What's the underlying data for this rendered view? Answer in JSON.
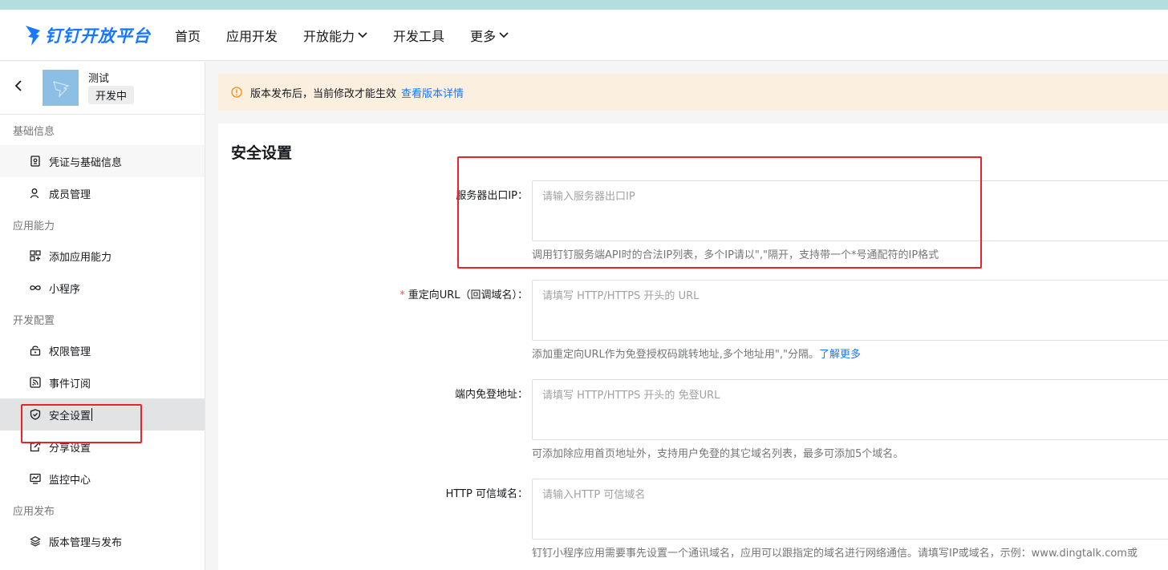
{
  "brand": {
    "name": "钉钉开放平台",
    "color": "#1677ff"
  },
  "nav": [
    {
      "label": "首页",
      "dropdown": false
    },
    {
      "label": "应用开发",
      "dropdown": false
    },
    {
      "label": "开放能力",
      "dropdown": true
    },
    {
      "label": "开发工具",
      "dropdown": false
    },
    {
      "label": "更多",
      "dropdown": true
    }
  ],
  "app": {
    "name": "测试",
    "status": "开发中"
  },
  "sidebar": {
    "groups": [
      {
        "label": "基础信息",
        "items": [
          {
            "label": "凭证与基础信息",
            "icon": "credential-icon"
          },
          {
            "label": "成员管理",
            "icon": "user-icon"
          }
        ]
      },
      {
        "label": "应用能力",
        "items": [
          {
            "label": "添加应用能力",
            "icon": "add-capability-icon"
          },
          {
            "label": "小程序",
            "icon": "link-icon"
          }
        ]
      },
      {
        "label": "开发配置",
        "items": [
          {
            "label": "权限管理",
            "icon": "lock-icon"
          },
          {
            "label": "事件订阅",
            "icon": "rss-icon"
          },
          {
            "label": "安全设置",
            "icon": "shield-icon",
            "active": true
          },
          {
            "label": "分享设置",
            "icon": "share-icon"
          },
          {
            "label": "监控中心",
            "icon": "monitor-icon"
          }
        ]
      },
      {
        "label": "应用发布",
        "items": [
          {
            "label": "版本管理与发布",
            "icon": "layers-icon"
          }
        ]
      }
    ]
  },
  "notice": {
    "text": "版本发布后，当前修改才能生效",
    "link": "查看版本详情"
  },
  "page_title": "安全设置",
  "form": {
    "fields": [
      {
        "label": "服务器出口IP：",
        "required": false,
        "placeholder": "请输入服务器出口IP",
        "hint": "调用钉钉服务端API时的合法IP列表，多个IP请以\",\"隔开，支持带一个*号通配符的IP格式",
        "hint_link": ""
      },
      {
        "label": "重定向URL（回调域名）：",
        "required": true,
        "placeholder": "请填写 HTTP/HTTPS 开头的 URL",
        "hint": "添加重定向URL作为免登授权码跳转地址,多个地址用\",\"分隔。",
        "hint_link": "了解更多"
      },
      {
        "label": "端内免登地址：",
        "required": false,
        "placeholder": "请填写 HTTP/HTTPS 开头的 免登URL",
        "hint": "可添加除应用首页地址外，支持用户免登的其它域名列表，最多可添加5个域名。",
        "hint_link": ""
      },
      {
        "label": "HTTP 可信域名：",
        "required": false,
        "placeholder": "请输入HTTP 可信域名",
        "hint": "钉钉小程序应用需要事先设置一个通讯域名，应用可以跟指定的域名进行网络通信。请填写IP或域名，示例：www.dingtalk.com或",
        "hint_link": ""
      }
    ]
  },
  "colors": {
    "highlight_box": "#e8232b",
    "notice_bg": "#fbefe0",
    "link": "#1677ff"
  }
}
